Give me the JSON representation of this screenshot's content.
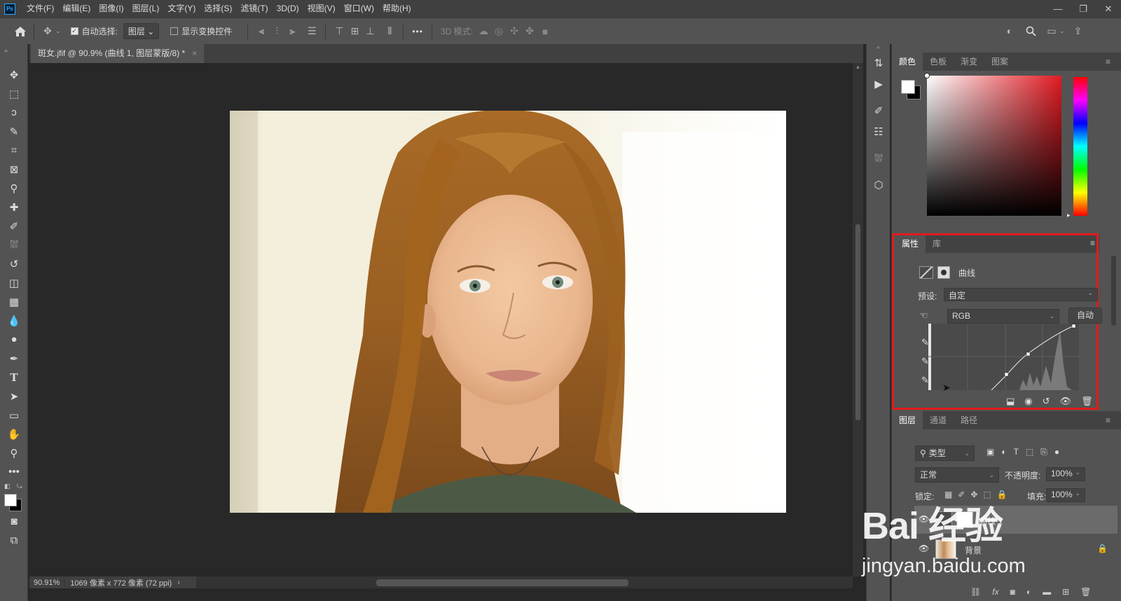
{
  "menubar": {
    "logo": "Ps",
    "items": [
      "文件(F)",
      "编辑(E)",
      "图像(I)",
      "图层(L)",
      "文字(Y)",
      "选择(S)",
      "滤镜(T)",
      "3D(D)",
      "视图(V)",
      "窗口(W)",
      "帮助(H)"
    ],
    "win_minimize": "—",
    "win_restore": "❐",
    "win_close": "✕"
  },
  "options": {
    "auto_select_label": "自动选择:",
    "auto_select_value": "图层",
    "show_transform_label": "显示变换控件",
    "more": "•••",
    "mode3d_label": "3D 模式:"
  },
  "document": {
    "tab_title": "斑女.jfif @ 90.9% (曲线 1, 图层蒙版/8) *",
    "tab_close": "×"
  },
  "status": {
    "zoom": "90.91%",
    "size_info": "1069 像素 x 772 像素 (72 ppi)",
    "arrow": "›"
  },
  "color_panel": {
    "tabs": [
      "颜色",
      "色板",
      "渐变",
      "图案"
    ],
    "active_tab": "颜色"
  },
  "properties_panel": {
    "tabs": [
      "属性",
      "库"
    ],
    "active_tab": "属性",
    "adjustment_name": "曲线",
    "preset_label": "预设:",
    "preset_value": "自定",
    "channel_value": "RGB",
    "auto_button": "自动"
  },
  "layers_panel": {
    "tabs": [
      "图层",
      "通道",
      "路径"
    ],
    "active_tab": "图层",
    "filter_label": "类型",
    "blend_mode": "正常",
    "opacity_label": "不透明度:",
    "opacity_value": "100%",
    "lock_label": "锁定:",
    "fill_label": "填充:",
    "fill_value": "100%",
    "layers": [
      {
        "name": "曲线 1"
      },
      {
        "name": "背景"
      }
    ]
  },
  "watermark": {
    "brand": "Bai 经验",
    "url": "jingyan.baidu.com"
  },
  "colors": {
    "highlight": "#e21b1b",
    "ui_dark": "#404040",
    "ui_mid": "#535353",
    "canvas_bg": "#282828"
  }
}
